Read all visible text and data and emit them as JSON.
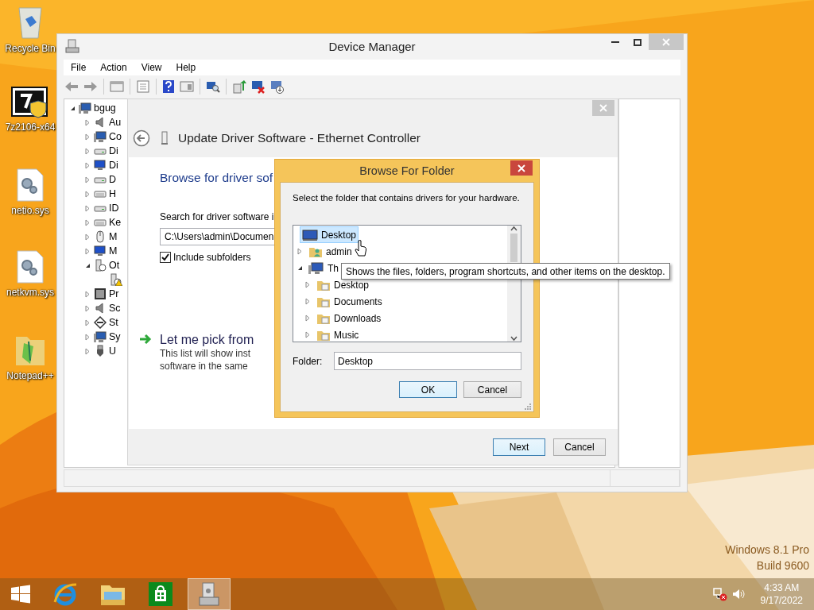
{
  "desktop_icons": [
    {
      "label": "Recycle Bin",
      "kind": "recycle-bin"
    },
    {
      "label": "7z2106-x64",
      "kind": "installer"
    },
    {
      "label": "netio.sys",
      "kind": "system-file"
    },
    {
      "label": "netkvm.sys",
      "kind": "system-file"
    },
    {
      "label": "Notepad++",
      "kind": "app-folder"
    }
  ],
  "os_edition": [
    "Windows 8.1 Pro",
    "Build 9600"
  ],
  "device_manager": {
    "title": "Device Manager",
    "menu": [
      "File",
      "Action",
      "View",
      "Help"
    ],
    "tree": {
      "label": "bgug",
      "kind": "computer",
      "expanded": true,
      "children": [
        {
          "label": "Au",
          "kind": "speaker",
          "expanded": false
        },
        {
          "label": "Co",
          "kind": "computer",
          "expanded": false
        },
        {
          "label": "Di",
          "kind": "drive",
          "expanded": false
        },
        {
          "label": "Di",
          "kind": "monitor",
          "expanded": false
        },
        {
          "label": "D",
          "kind": "drive",
          "expanded": false
        },
        {
          "label": "H",
          "kind": "keyboard",
          "expanded": false
        },
        {
          "label": "ID",
          "kind": "drive",
          "expanded": false
        },
        {
          "label": "Ke",
          "kind": "keyboard",
          "expanded": false
        },
        {
          "label": "M",
          "kind": "mouse",
          "expanded": false
        },
        {
          "label": "M",
          "kind": "monitor",
          "expanded": false
        },
        {
          "label": "Ot",
          "kind": "unknown",
          "expanded": true,
          "children": [
            {
              "kind": "unknown",
              "warning": true
            }
          ]
        },
        {
          "label": "Pr",
          "kind": "chip",
          "expanded": false
        },
        {
          "label": "Sc",
          "kind": "speaker",
          "expanded": false
        },
        {
          "label": "St",
          "kind": "storage",
          "expanded": false
        },
        {
          "label": "Sy",
          "kind": "computer",
          "expanded": false
        },
        {
          "label": "U",
          "kind": "usb",
          "expanded": false
        }
      ]
    }
  },
  "update_driver": {
    "title": "Update Driver Software - Ethernet Controller",
    "heading": "Browse for driver sof",
    "search_label": "Search for driver software i",
    "path": "C:\\Users\\admin\\Documen",
    "include_subfolders": {
      "label": "Include subfolders",
      "checked": true
    },
    "pick_link": "Let me pick from",
    "pick_lines": [
      "This list will show inst",
      "software in the same"
    ],
    "buttons": [
      "Next",
      "Cancel"
    ]
  },
  "browse_folder": {
    "title": "Browse For Folder",
    "instruction": "Select the folder that contains drivers for your hardware.",
    "tree": [
      {
        "label": "Desktop",
        "kind": "desktop",
        "selected": true
      },
      {
        "label": "admin",
        "kind": "user",
        "selected": false,
        "expanded": false
      },
      {
        "label": "Th",
        "kind": "computer",
        "selected": false,
        "expanded": true,
        "children": [
          {
            "label": "Desktop",
            "kind": "folder",
            "selected": false,
            "expanded": false
          },
          {
            "label": "Documents",
            "kind": "folder",
            "selected": false,
            "expanded": false
          },
          {
            "label": "Downloads",
            "kind": "folder",
            "selected": false,
            "expanded": false
          },
          {
            "label": "Music",
            "kind": "folder",
            "selected": false,
            "expanded": false
          }
        ]
      }
    ],
    "folder_label": "Folder:",
    "folder_value": "Desktop",
    "buttons": [
      "OK",
      "Cancel"
    ]
  },
  "tooltip": "Shows the files, folders, program shortcuts, and other items on the desktop.",
  "taskbar": {
    "apps": [
      {
        "kind": "browser",
        "active": false
      },
      {
        "kind": "file-explorer",
        "active": false
      },
      {
        "kind": "store",
        "active": false
      },
      {
        "kind": "device-manager",
        "active": true
      }
    ],
    "time": "4:33 AM",
    "date": "9/17/2022"
  }
}
